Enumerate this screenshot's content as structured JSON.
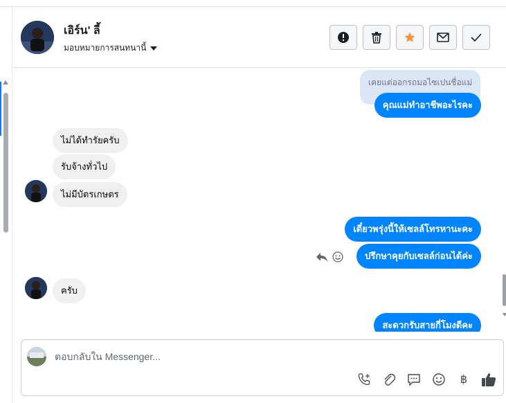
{
  "header": {
    "user_name": "เอิร์น' ลี้",
    "assign_label": "มอบหมายการสนทนานี้"
  },
  "header_buttons": [
    {
      "name": "mark-spam-button",
      "icon": "exclamation-icon"
    },
    {
      "name": "delete-button",
      "icon": "trash-icon"
    },
    {
      "name": "star-button",
      "icon": "star-icon",
      "color": "#f7923b"
    },
    {
      "name": "mark-unread-button",
      "icon": "envelope-icon"
    },
    {
      "name": "mark-done-button",
      "icon": "check-icon"
    }
  ],
  "messages": {
    "quoted_reply": "เคยแต่ออกรถมอไซเปนชื่อแม่",
    "m1": "คุณแม่ทำอาชีพอะไรคะ",
    "m2": "ไม่ได้ทำรัยครับ",
    "m3": "รับจ้างทั่วไป",
    "m4": "ไม่มีบัตรเกษตร",
    "m5": "เดี๋ยวพรุ่งนี้ให้เซลล์โทรหานะคะ",
    "m6": "ปรึกษาคุยกับเซลล์ก่อนได้ค่ะ",
    "m7": "ครับ",
    "m8": "สะดวกรับสายกี่โมงดีคะ"
  },
  "composer": {
    "placeholder": "ตอบกลับใน Messenger...",
    "currency_symbol": "฿"
  },
  "colors": {
    "outgoing_bubble": "#0084ff",
    "incoming_bubble": "#f0f0f0",
    "accent": "#1877f2",
    "star": "#f7923b",
    "like": "#444950"
  }
}
